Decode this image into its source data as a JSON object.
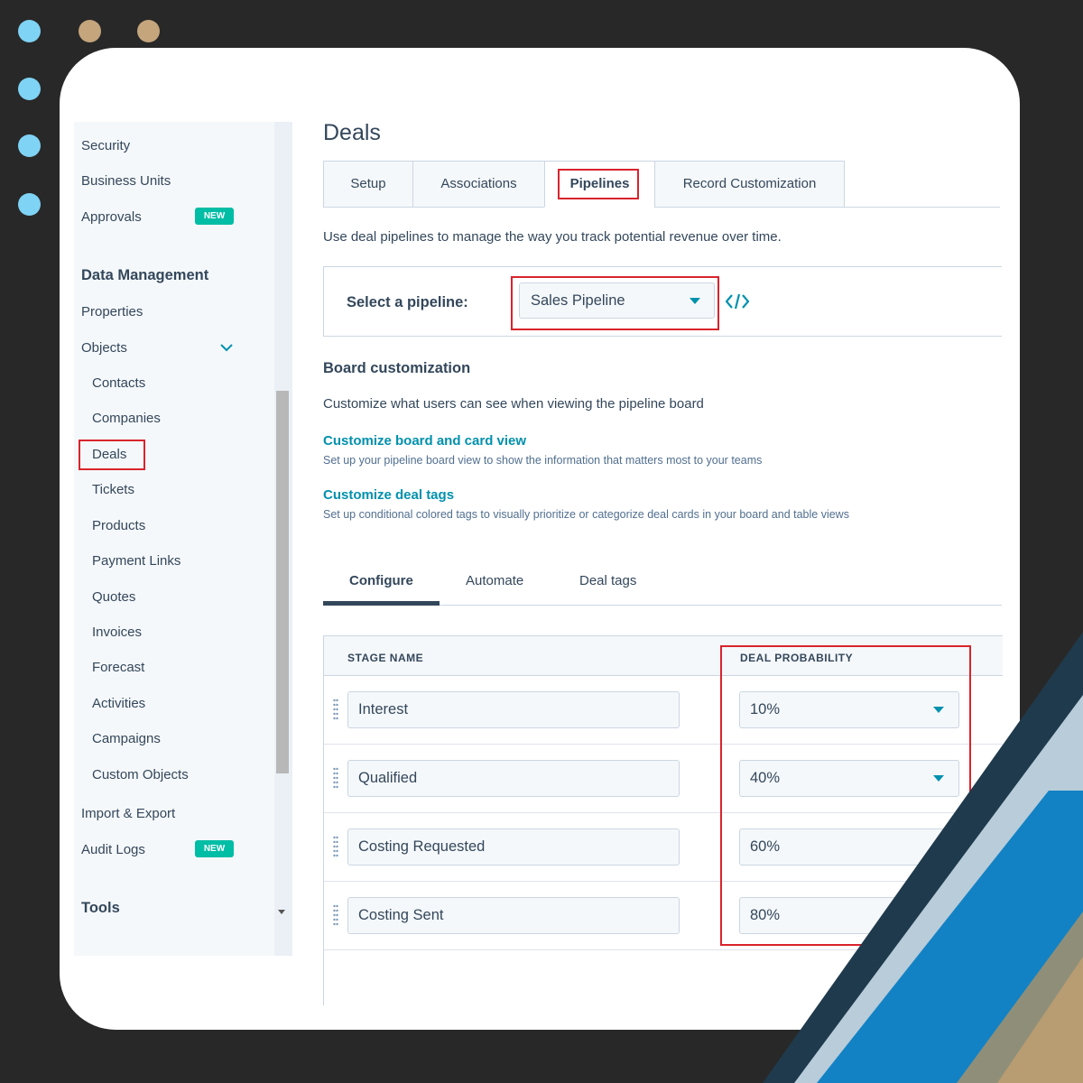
{
  "sidebar": {
    "items_top": [
      {
        "label": "Security"
      },
      {
        "label": "Business Units"
      },
      {
        "label": "Approvals",
        "badge": "NEW"
      }
    ],
    "data_management_heading": "Data Management",
    "properties_label": "Properties",
    "objects_label": "Objects",
    "objects_children": [
      "Contacts",
      "Companies",
      "Deals",
      "Tickets",
      "Products",
      "Payment Links",
      "Quotes",
      "Invoices",
      "Forecast",
      "Activities",
      "Campaigns",
      "Custom Objects"
    ],
    "import_export_label": "Import & Export",
    "audit_logs_label": "Audit Logs",
    "audit_logs_badge": "NEW",
    "tools_heading": "Tools"
  },
  "main": {
    "title": "Deals",
    "tabs": [
      "Setup",
      "Associations",
      "Pipelines",
      "Record Customization"
    ],
    "active_tab": "Pipelines",
    "description": "Use deal pipelines to manage the way you track potential revenue over time.",
    "pipeline_label": "Select a pipeline:",
    "pipeline_value": "Sales Pipeline",
    "board_title": "Board customization",
    "board_desc": "Customize what users can see when viewing the pipeline board",
    "link1_title": "Customize board and card view",
    "link1_desc": "Set up your pipeline board view to show the information that matters most to your teams",
    "link2_title": "Customize deal tags",
    "link2_desc": "Set up conditional colored tags to visually prioritize or categorize deal cards in your board and table views",
    "subtabs": [
      "Configure",
      "Automate",
      "Deal tags"
    ],
    "active_subtab": "Configure",
    "table": {
      "col_stage": "STAGE NAME",
      "col_prob": "DEAL PROBABILITY",
      "rows": [
        {
          "stage": "Interest",
          "prob": "10%"
        },
        {
          "stage": "Qualified",
          "prob": "40%"
        },
        {
          "stage": "Costing Requested",
          "prob": "60%"
        },
        {
          "stage": "Costing Sent",
          "prob": "80%"
        }
      ]
    }
  },
  "colors": {
    "accent": "#0091ae",
    "badge": "#00bda5",
    "highlight": "#d9242c",
    "text": "#33475b"
  }
}
